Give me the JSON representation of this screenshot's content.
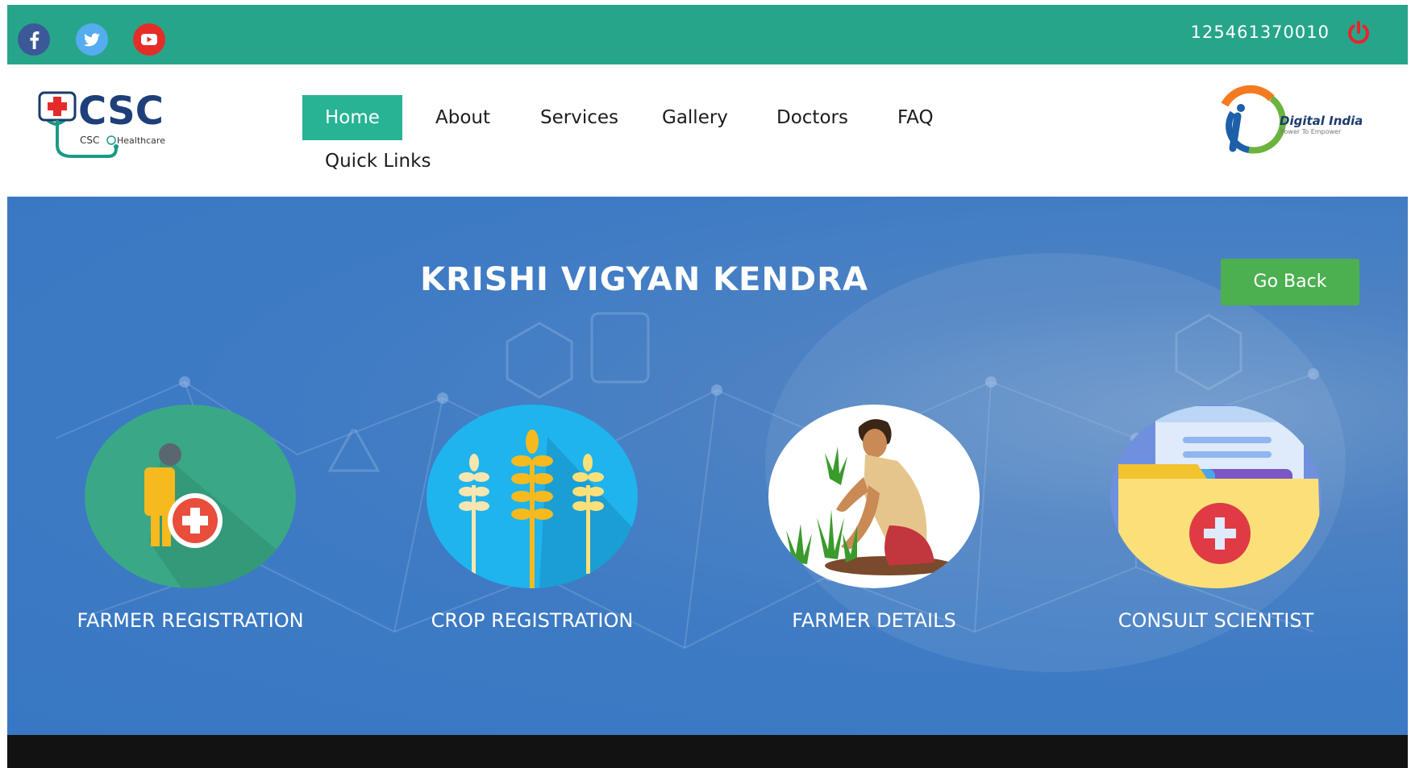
{
  "topbar": {
    "social": [
      {
        "name": "facebook-icon",
        "color": "#3b5998"
      },
      {
        "name": "twitter-icon",
        "color": "#55acee"
      },
      {
        "name": "youtube-icon",
        "color": "#e52d27"
      }
    ],
    "phone": "125461370010",
    "power_icon": "power-icon"
  },
  "header": {
    "logo": {
      "main": "CSC",
      "sub": "CSC",
      "sub2": "Healthcare"
    },
    "nav": [
      {
        "label": "Home",
        "active": true
      },
      {
        "label": "About"
      },
      {
        "label": "Services"
      },
      {
        "label": "Gallery"
      },
      {
        "label": "Doctors"
      },
      {
        "label": "FAQ"
      },
      {
        "label": "Quick Links"
      }
    ],
    "digital_india": {
      "title": "Digital India",
      "tagline": "Power To Empower"
    }
  },
  "hero": {
    "title": "KRISHI VIGYAN KENDRA",
    "go_back": "Go Back",
    "cards": [
      {
        "label": "FARMER REGISTRATION",
        "icon": "farmer-registration-icon"
      },
      {
        "label": "CROP REGISTRATION",
        "icon": "wheat-icon"
      },
      {
        "label": "FARMER DETAILS",
        "icon": "farmer-illustration-icon"
      },
      {
        "label": "CONSULT SCIENTIST",
        "icon": "medical-folder-icon"
      }
    ]
  },
  "colors": {
    "topbar": "#27a58b",
    "nav_active": "#27b394",
    "go_back": "#4caf50",
    "hero": "#3e7bc4",
    "footer": "#121212"
  }
}
